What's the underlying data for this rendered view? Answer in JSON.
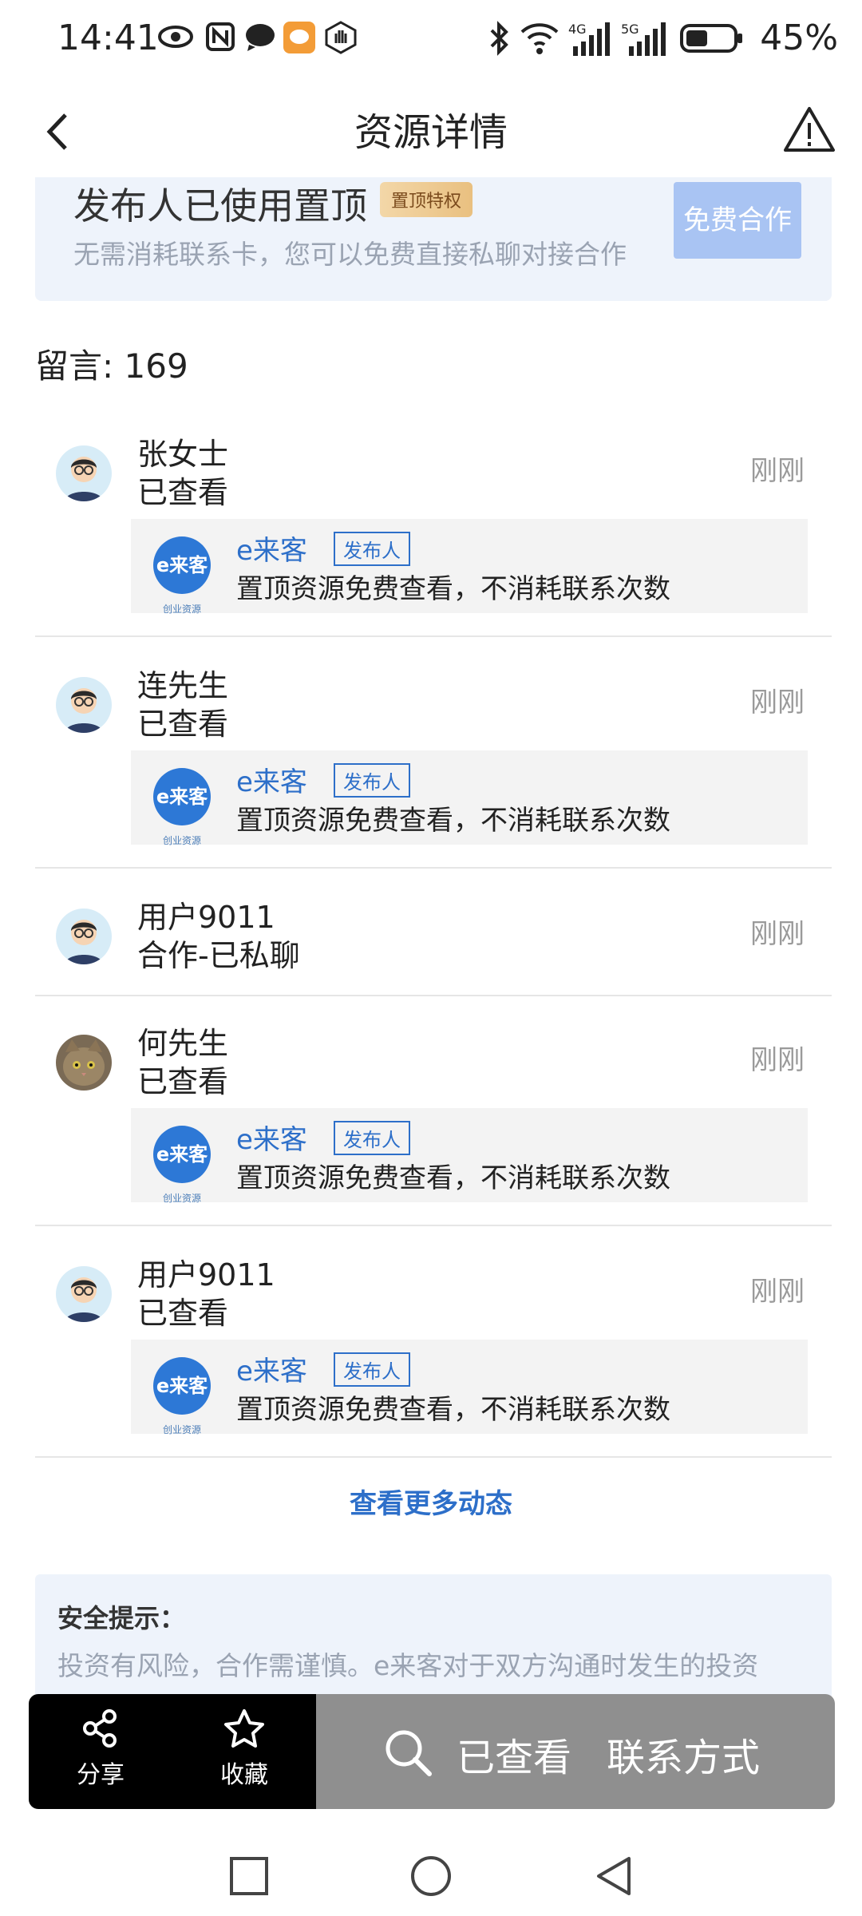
{
  "status_bar": {
    "time": "14:41",
    "battery": "45%",
    "icons": [
      "eye-icon",
      "nfc-icon",
      "chat-bubble-icon",
      "app-notification-icon",
      "hand-icon",
      "bluetooth-icon",
      "wifi-icon",
      "signal-4g-icon",
      "signal-5g-icon",
      "battery-icon"
    ]
  },
  "header": {
    "title": "资源详情",
    "back_icon": "back-arrow-icon",
    "report_icon": "warning-icon"
  },
  "banner": {
    "title": "发布人已使用置顶",
    "badge": "置顶特权",
    "subtitle": "无需消耗联系卡，您可以免费直接私聊对接合作",
    "button": "免费合作"
  },
  "comments": {
    "label": "留言: 169",
    "items": [
      {
        "name": "张女士",
        "status": "已查看",
        "time": "刚刚",
        "reply": {
          "logo_text": "e来客",
          "logo_sub": "创业资源",
          "name": "e来客",
          "tag": "发布人",
          "text": "置顶资源免费查看，不消耗联系次数"
        }
      },
      {
        "name": "连先生",
        "status": "已查看",
        "time": "刚刚",
        "reply": {
          "logo_text": "e来客",
          "logo_sub": "创业资源",
          "name": "e来客",
          "tag": "发布人",
          "text": "置顶资源免费查看，不消耗联系次数"
        }
      },
      {
        "name": "用户9011",
        "status": "合作-已私聊",
        "time": "刚刚"
      },
      {
        "name": "何先生",
        "status": "已查看",
        "time": "刚刚",
        "reply": {
          "logo_text": "e来客",
          "logo_sub": "创业资源",
          "name": "e来客",
          "tag": "发布人",
          "text": "置顶资源免费查看，不消耗联系次数"
        }
      },
      {
        "name": "用户9011",
        "status": "已查看",
        "time": "刚刚",
        "reply": {
          "logo_text": "e来客",
          "logo_sub": "创业资源",
          "name": "e来客",
          "tag": "发布人",
          "text": "置顶资源免费查看，不消耗联系次数"
        }
      }
    ],
    "more": "查看更多动态"
  },
  "safety": {
    "title": "安全提示：",
    "text": "投资有风险，合作需谨慎。e来客对于双方沟通时发生的投资"
  },
  "action_bar": {
    "share": "分享",
    "favorite": "收藏",
    "viewed": "已查看",
    "contact": "联系方式"
  },
  "nav": {
    "recent": "square-icon",
    "home": "circle-icon",
    "back": "triangle-back-icon"
  },
  "colors": {
    "accent_blue": "#2d6fc9",
    "banner_bg": "#eef3fb",
    "free_button": "#a9c4f3",
    "action_left": "#000000",
    "action_right": "#8f8f8f"
  }
}
